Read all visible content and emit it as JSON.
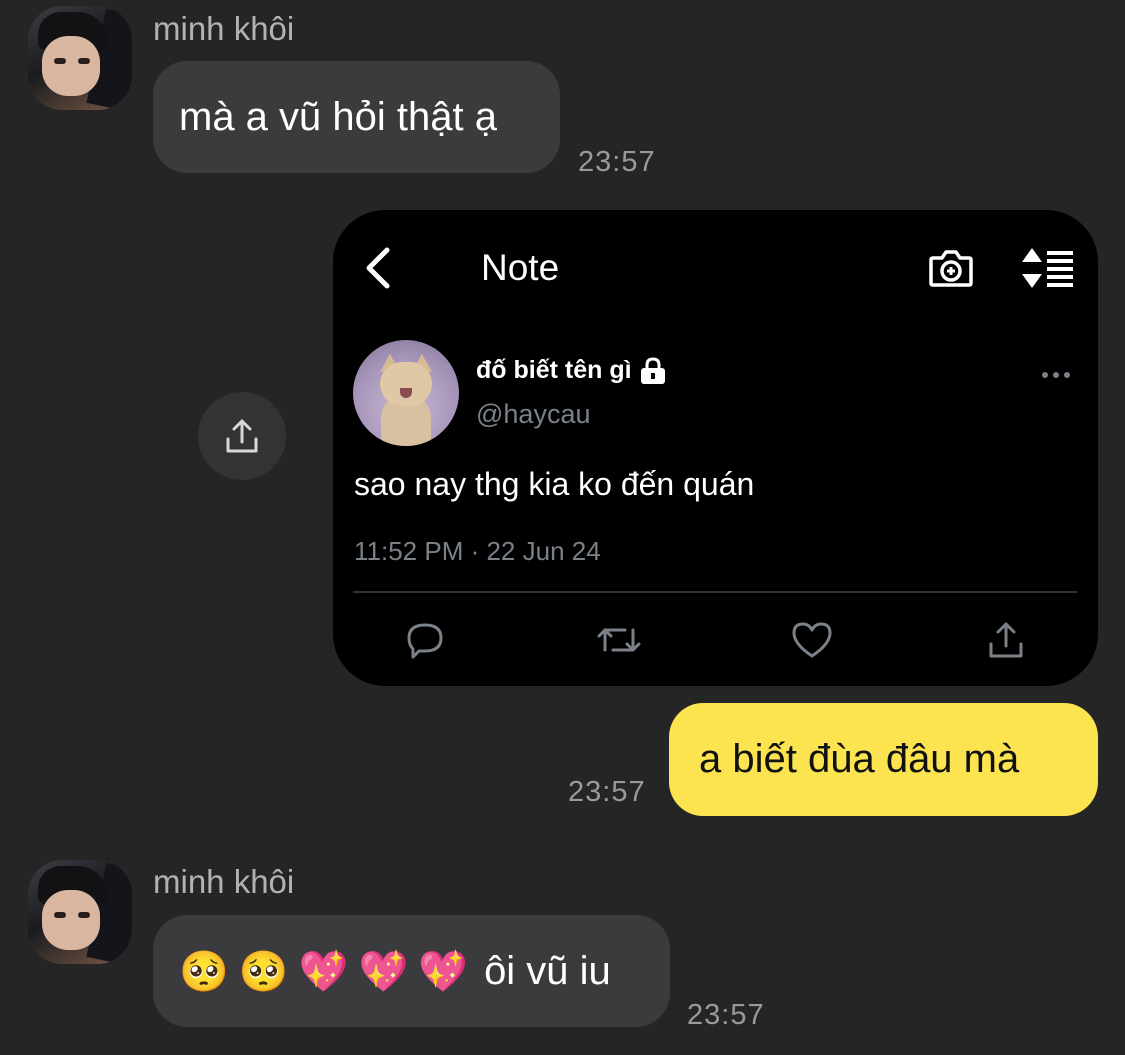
{
  "messages": [
    {
      "sender": "minh khôi",
      "text": "mà a vũ hỏi thật ạ",
      "time": "23:57"
    },
    {
      "sender": "me",
      "text": "a biết đùa đâu mà",
      "time": "23:57"
    },
    {
      "sender": "minh khôi",
      "text": "ôi vũ iu",
      "emojis": [
        "🥺",
        "🥺",
        "💖",
        "💖",
        "💖"
      ],
      "time": "23:57"
    }
  ],
  "shared_note": {
    "title": "Note",
    "author_name": "đố biết tên gì",
    "author_handle": "@haycau",
    "text": "sao nay thg kia ko đến quán",
    "meta": "11:52 PM · 22 Jun 24",
    "icons": [
      "back-icon",
      "camera-add-icon",
      "sort-list-icon",
      "lock-icon",
      "more-icon",
      "reply-icon",
      "retweet-icon",
      "like-icon",
      "share-icon"
    ]
  },
  "colors": {
    "background": "#252526",
    "incoming_bubble": "#3b3b3d",
    "outgoing_bubble": "#fbe44f",
    "card_background": "#000000",
    "muted_text": "#7b8188"
  }
}
